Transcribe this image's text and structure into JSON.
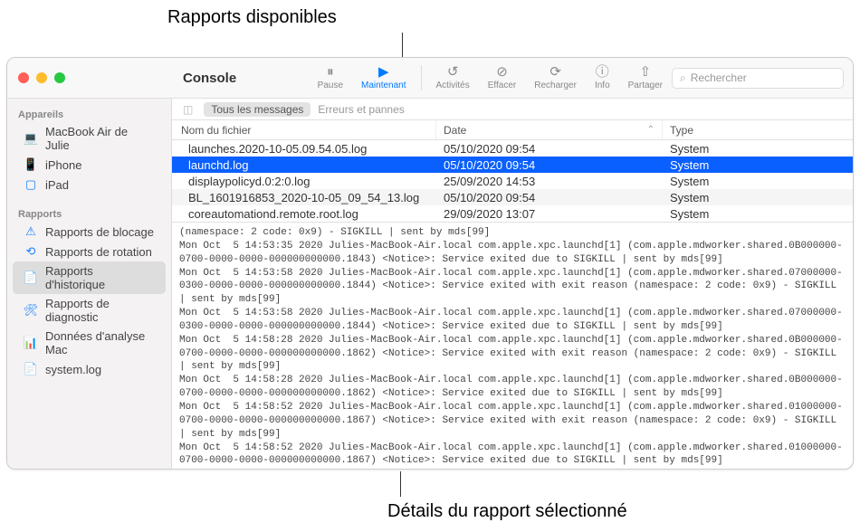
{
  "annotations": {
    "top": "Rapports disponibles",
    "bottom": "Détails du rapport sélectionné"
  },
  "window": {
    "title": "Console"
  },
  "toolbar": {
    "pause": "Pause",
    "now": "Maintenant",
    "activities": "Activités",
    "clear": "Effacer",
    "reload": "Recharger",
    "info": "Info",
    "share": "Partager",
    "search_placeholder": "Rechercher"
  },
  "filterbar": {
    "all_messages": "Tous les messages",
    "errors_faults": "Erreurs et pannes"
  },
  "table": {
    "headers": {
      "name": "Nom du fichier",
      "date": "Date",
      "type": "Type"
    },
    "rows": [
      {
        "name": "launches.2020-10-05.09.54.05.log",
        "date": "05/10/2020 09:54",
        "type": "System"
      },
      {
        "name": "launchd.log",
        "date": "05/10/2020 09:54",
        "type": "System"
      },
      {
        "name": "displaypolicyd.0:2:0.log",
        "date": "25/09/2020 14:53",
        "type": "System"
      },
      {
        "name": "BL_1601916853_2020-10-05_09_54_13.log",
        "date": "05/10/2020 09:54",
        "type": "System"
      },
      {
        "name": "coreautomationd.remote.root.log",
        "date": "29/09/2020 13:07",
        "type": "System"
      }
    ]
  },
  "sidebar": {
    "devices_header": "Appareils",
    "devices": [
      {
        "icon": "laptop",
        "label": "MacBook Air de Julie"
      },
      {
        "icon": "phone",
        "label": "iPhone"
      },
      {
        "icon": "tablet",
        "label": "iPad"
      }
    ],
    "reports_header": "Rapports",
    "reports": [
      {
        "icon": "warning",
        "label": "Rapports de blocage"
      },
      {
        "icon": "rotate",
        "label": "Rapports de rotation"
      },
      {
        "icon": "doc",
        "label": "Rapports d'historique"
      },
      {
        "icon": "wrench",
        "label": "Rapports de diagnostic"
      },
      {
        "icon": "chart",
        "label": "Données d'analyse Mac"
      },
      {
        "icon": "doc",
        "label": "system.log"
      }
    ]
  },
  "log_content": "(namespace: 2 code: 0x9) - SIGKILL | sent by mds[99]\nMon Oct  5 14:53:35 2020 Julies-MacBook-Air.local com.apple.xpc.launchd[1] (com.apple.mdworker.shared.0B000000-0700-0000-0000-000000000000.1843) <Notice>: Service exited due to SIGKILL | sent by mds[99]\nMon Oct  5 14:53:58 2020 Julies-MacBook-Air.local com.apple.xpc.launchd[1] (com.apple.mdworker.shared.07000000-0300-0000-0000-000000000000.1844) <Notice>: Service exited with exit reason (namespace: 2 code: 0x9) - SIGKILL | sent by mds[99]\nMon Oct  5 14:53:58 2020 Julies-MacBook-Air.local com.apple.xpc.launchd[1] (com.apple.mdworker.shared.07000000-0300-0000-0000-000000000000.1844) <Notice>: Service exited due to SIGKILL | sent by mds[99]\nMon Oct  5 14:58:28 2020 Julies-MacBook-Air.local com.apple.xpc.launchd[1] (com.apple.mdworker.shared.0B000000-0700-0000-0000-000000000000.1862) <Notice>: Service exited with exit reason (namespace: 2 code: 0x9) - SIGKILL | sent by mds[99]\nMon Oct  5 14:58:28 2020 Julies-MacBook-Air.local com.apple.xpc.launchd[1] (com.apple.mdworker.shared.0B000000-0700-0000-0000-000000000000.1862) <Notice>: Service exited due to SIGKILL | sent by mds[99]\nMon Oct  5 14:58:52 2020 Julies-MacBook-Air.local com.apple.xpc.launchd[1] (com.apple.mdworker.shared.01000000-0700-0000-0000-000000000000.1867) <Notice>: Service exited with exit reason (namespace: 2 code: 0x9) - SIGKILL | sent by mds[99]\nMon Oct  5 14:58:52 2020 Julies-MacBook-Air.local com.apple.xpc.launchd[1] (com.apple.mdworker.shared.01000000-0700-0000-0000-000000000000.1867) <Notice>: Service exited due to SIGKILL | sent by mds[99]"
}
